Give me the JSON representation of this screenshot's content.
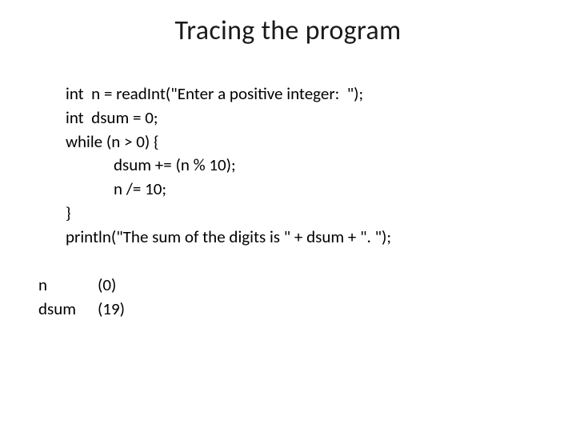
{
  "title": "Tracing the program",
  "code": {
    "l1": "int  n = readInt(\"Enter a positive integer:  \");",
    "l2": "int  dsum = 0;",
    "l3": "while (n > 0) {",
    "l4": "dsum += (n % 10);",
    "l5": "n /= 10;",
    "l6": "}",
    "l7": "println(\"The sum of the digits is \" + dsum + \". \");"
  },
  "trace": {
    "var1": "n",
    "val1": "(0)",
    "var2": "dsum",
    "val2": "(19)"
  }
}
